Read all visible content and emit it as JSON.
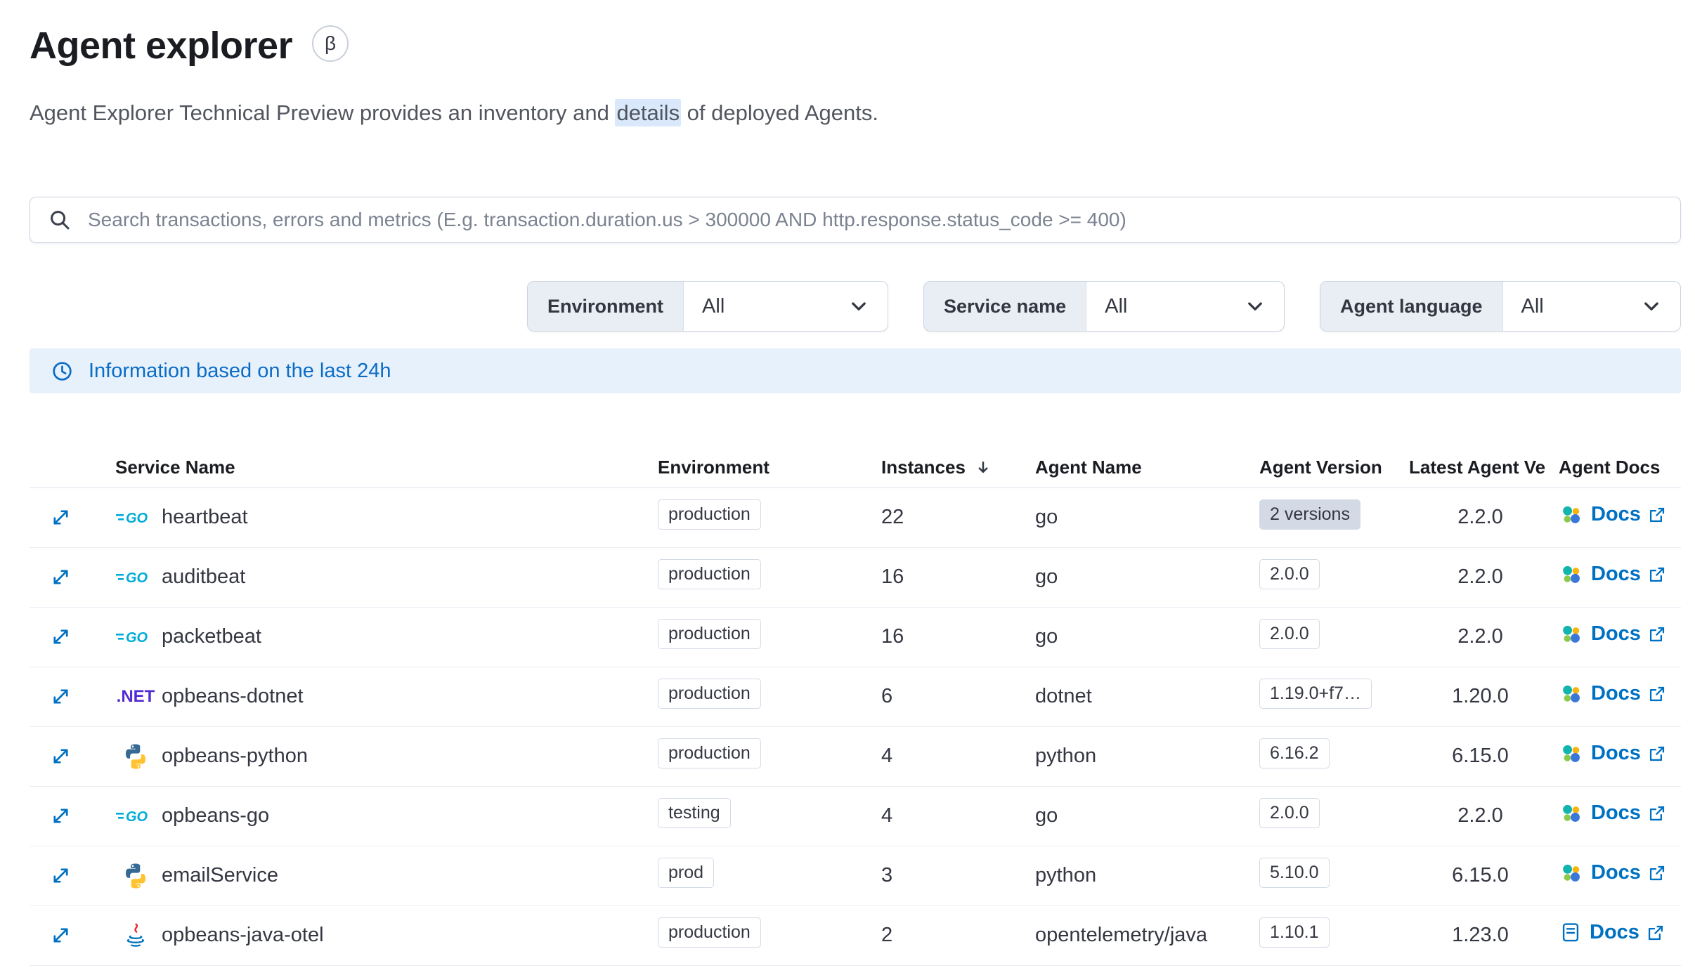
{
  "page": {
    "title": "Agent explorer",
    "beta_badge": "β",
    "subtitle": {
      "pre": "Agent Explorer Technical Preview provides an inventory and ",
      "highlight": "details",
      "post": " of deployed Agents."
    }
  },
  "search": {
    "placeholder": "Search transactions, errors and metrics (E.g. transaction.duration.us > 300000 AND http.response.status_code >= 400)"
  },
  "filters": [
    {
      "label": "Environment",
      "value": "All"
    },
    {
      "label": "Service name",
      "value": "All"
    },
    {
      "label": "Agent language",
      "value": "All"
    }
  ],
  "banner": {
    "text": "Information based on the last 24h"
  },
  "icons": {
    "go_text": "GO",
    "dotnet_text": ".NET"
  },
  "table": {
    "headers": {
      "service_name": "Service Name",
      "environment": "Environment",
      "instances": "Instances",
      "agent_name": "Agent Name",
      "agent_version": "Agent Version",
      "latest_agent_version": "Latest Agent Ve",
      "agent_docs": "Agent Docs"
    },
    "docs_label": "Docs",
    "rows": [
      {
        "service": "heartbeat",
        "language": "go",
        "environment": "production",
        "instances": "22",
        "agent_name": "go",
        "version": "2 versions",
        "version_filled": true,
        "latest": "2.2.0",
        "docs_icon": "agent"
      },
      {
        "service": "auditbeat",
        "language": "go",
        "environment": "production",
        "instances": "16",
        "agent_name": "go",
        "version": "2.0.0",
        "version_filled": false,
        "latest": "2.2.0",
        "docs_icon": "agent"
      },
      {
        "service": "packetbeat",
        "language": "go",
        "environment": "production",
        "instances": "16",
        "agent_name": "go",
        "version": "2.0.0",
        "version_filled": false,
        "latest": "2.2.0",
        "docs_icon": "agent"
      },
      {
        "service": "opbeans-dotnet",
        "language": "dotnet",
        "environment": "production",
        "instances": "6",
        "agent_name": "dotnet",
        "version": "1.19.0+f7…",
        "version_filled": false,
        "latest": "1.20.0",
        "docs_icon": "agent"
      },
      {
        "service": "opbeans-python",
        "language": "python",
        "environment": "production",
        "instances": "4",
        "agent_name": "python",
        "version": "6.16.2",
        "version_filled": false,
        "latest": "6.15.0",
        "docs_icon": "agent"
      },
      {
        "service": "opbeans-go",
        "language": "go",
        "environment": "testing",
        "instances": "4",
        "agent_name": "go",
        "version": "2.0.0",
        "version_filled": false,
        "latest": "2.2.0",
        "docs_icon": "agent"
      },
      {
        "service": "emailService",
        "language": "python",
        "environment": "prod",
        "instances": "3",
        "agent_name": "python",
        "version": "5.10.0",
        "version_filled": false,
        "latest": "6.15.0",
        "docs_icon": "agent"
      },
      {
        "service": "opbeans-java-otel",
        "language": "java",
        "environment": "production",
        "instances": "2",
        "agent_name": "opentelemetry/java",
        "version": "1.10.1",
        "version_filled": false,
        "latest": "1.23.0",
        "docs_icon": "book"
      }
    ]
  }
}
